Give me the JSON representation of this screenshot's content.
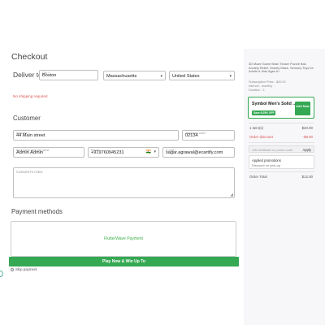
{
  "checkout": {
    "title": "Checkout",
    "deliver_label": "Deliver to",
    "city": {
      "label": "City *",
      "value": "Boston"
    },
    "state": "Massachusetts",
    "country": "United States",
    "shipping_warning": "No shipping required"
  },
  "customer": {
    "heading": "Customer",
    "address": {
      "label": "Address *",
      "value": "44 Main street"
    },
    "zip": {
      "label": "Zip/postal code *",
      "value": "02134"
    },
    "name": {
      "label": "First name and last name",
      "value": "Admin Admin"
    },
    "phone": {
      "label": "Phone",
      "value": "+919760945231"
    },
    "email": {
      "label": "E-mail *",
      "value": "sagar.agrawal@ecartify.com"
    },
    "flag": "🇮🇳",
    "notes_placeholder": "Customer's notes"
  },
  "payment": {
    "heading": "Payment methods",
    "method": "FlutterWave Payment",
    "play_button": "Play Now & Win Up To",
    "skip_label": "Skip payment"
  },
  "order_summary": {
    "product_title": "3D Maze Game Brain Teaser Puzzle Ball, Anxiety Relief, Gravity Maze, Sensory Toys for Adults & Kids Ages 6+",
    "subscription_price": "Subscription Price - $20.00",
    "interval": "Interval - monthly",
    "duration": "Duration - 1",
    "offer": {
      "title": "Symbol Men's Solid ...",
      "badge": "Save 6.25% OFF",
      "add_button": "Add Now"
    },
    "items_label": "1 item(s)",
    "items_value": "$20.00",
    "discount_label": "Order discount",
    "discount_value": "-$8.00",
    "coupon_placeholder": "Gift certificate or promo code",
    "apply_label": "Apply",
    "applied_title": "Applied promotions",
    "applied_detail": "Discount on pick-up",
    "total_label": "Order Total",
    "total_value": "$12.00"
  },
  "colors": {
    "accent_green": "#34a853",
    "warning_red": "#d9534f"
  }
}
